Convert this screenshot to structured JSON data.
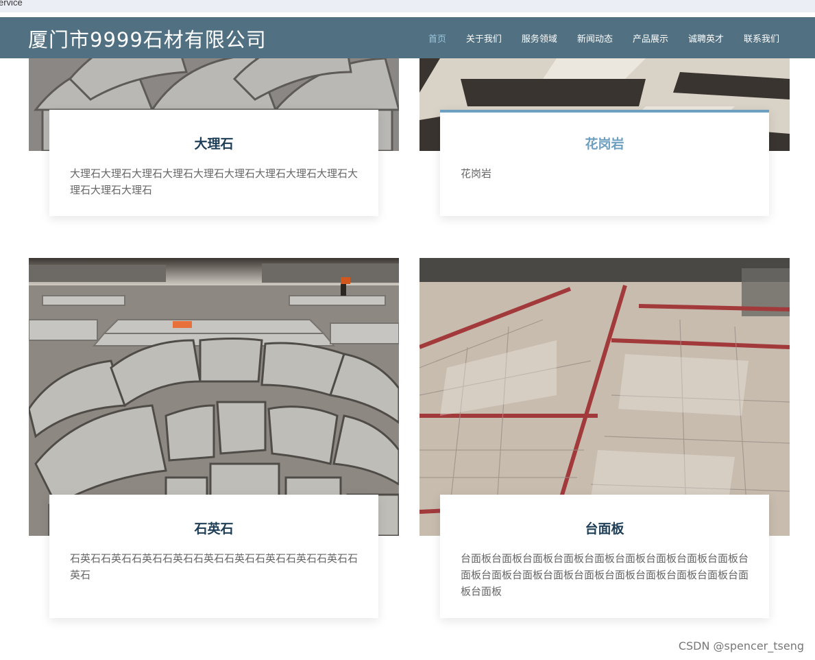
{
  "top_strip_text": "ervice",
  "brand": "厦门市9999石材有限公司",
  "nav": {
    "items": [
      {
        "label": "首页",
        "active": true
      },
      {
        "label": "关于我们"
      },
      {
        "label": "服务领域"
      },
      {
        "label": "新闻动态"
      },
      {
        "label": "产品展示"
      },
      {
        "label": "诚聘英才"
      },
      {
        "label": "联系我们"
      }
    ]
  },
  "products": [
    {
      "title": "大理石",
      "desc": "大理石大理石大理石大理石大理石大理石大理石大理石大理石大理石大理石大理石"
    },
    {
      "title": "花岗岩",
      "desc": "花岗岩",
      "active": true
    },
    {
      "title": "石英石",
      "desc": "石英石石英石石英石石英石石英石石英石石英石石英石石英石石英石"
    },
    {
      "title": "台面板",
      "desc": "台面板台面板台面板台面板台面板台面板台面板台面板台面板台面板台面板台面板台面板台面板台面板台面板台面板台面板台面板台面板"
    }
  ],
  "colors": {
    "nav_bg": "#2b5066",
    "accent": "#6d9fc0",
    "title": "#1d3e56"
  },
  "watermark": "CSDN @spencer_tseng"
}
